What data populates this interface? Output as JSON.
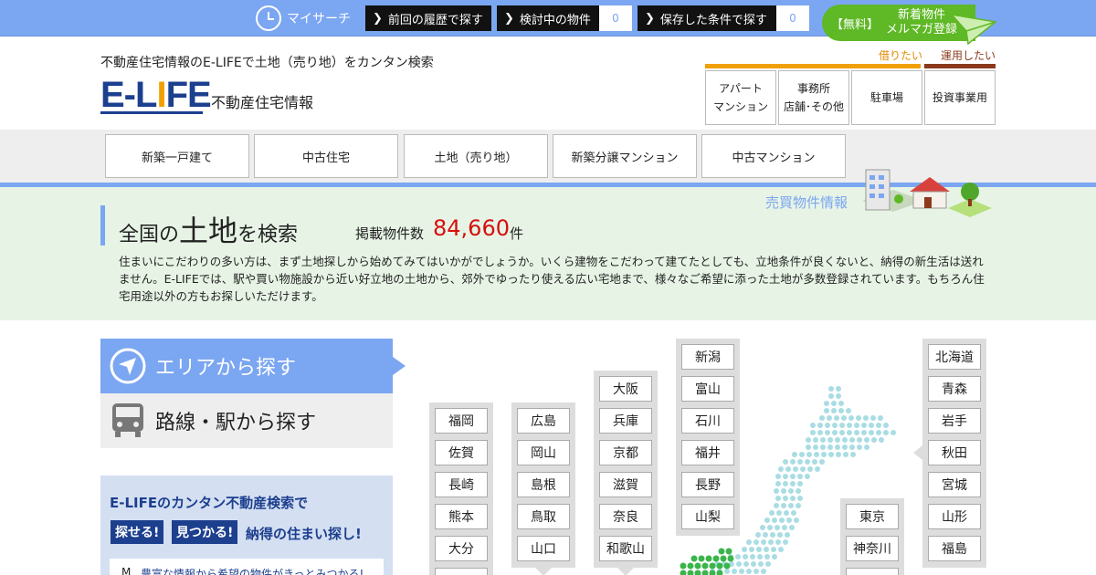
{
  "topbar": {
    "my_search": "マイサーチ",
    "history_label": "前回の履歴で探す",
    "considering_label": "検討中の物件",
    "considering_count": "0",
    "saved_label": "保存した条件で探す",
    "saved_count": "0",
    "mailmag_free": "【無料】",
    "mailmag_line1": "新着物件",
    "mailmag_line2": "メルマガ登録"
  },
  "header": {
    "tagline": "不動産住宅情報のE-LIFEで土地（売り地）をカンタン検索",
    "logo_e": "E-L",
    "logo_i": "I",
    "logo_fe": "FE",
    "logo_sub": "不動産住宅情報",
    "rent_label": "借りたい",
    "invest_label": "運用したい",
    "categories": [
      "アパート\nマンション",
      "事務所\n店舗･その他",
      "駐車場",
      "投資事業用"
    ]
  },
  "nav": {
    "tabs": [
      "新築一戸建て",
      "中古住宅",
      "土地（売り地）",
      "新築分譲マンション",
      "中古マンション"
    ]
  },
  "hero": {
    "title_pre": "全国の",
    "title_big": "土地",
    "title_post": "を検索",
    "count_label": "掲載物件数",
    "count": "84,660",
    "count_unit": "件",
    "sale_label": "売買物件情報",
    "description": "住まいにこだわりの多い方は、まず土地探しから始めてみてはいかがでしょうか。いくら建物をこだわって建てたとしても、立地条件が良くないと、納得の新生活は送れません。E-LIFEでは、駅や買い物施設から近い好立地の土地から、郊外でゆったり使える広い宅地まで、様々なご希望に添った土地が多数登録されています。もちろん住宅用途以外の方もお探しいただけます。"
  },
  "search": {
    "area_tab": "エリアから探す",
    "station_tab": "路線・駅から探す"
  },
  "promo": {
    "headline": "E-LIFEのカンタン不動産検索で",
    "badge1": "探せる!",
    "badge2": "見つかる!",
    "tail": "納得の住まい探し!",
    "item1": "豊富な情報から希望の物件がきっとみつかる!",
    "item1_marker": "M"
  },
  "regions": {
    "kyushu": [
      "福岡",
      "佐賀",
      "長崎",
      "熊本",
      "大分"
    ],
    "chugoku": [
      "広島",
      "岡山",
      "島根",
      "鳥取",
      "山口"
    ],
    "kansai": [
      "大阪",
      "兵庫",
      "京都",
      "滋賀",
      "奈良",
      "和歌山"
    ],
    "chubu": [
      "新潟",
      "富山",
      "石川",
      "福井",
      "長野",
      "山梨"
    ],
    "kanto": [
      "東京",
      "神奈川"
    ],
    "tohoku": [
      "北海道",
      "青森",
      "岩手",
      "秋田",
      "宮城",
      "山形",
      "福島"
    ]
  },
  "colors": {
    "primary_blue": "#7ba6f1",
    "logo_navy": "#1c3f8e",
    "accent_orange": "#f0a000",
    "invest_brown": "#8b3a1c",
    "hero_green": "#e7f4e5",
    "count_red": "#d6100f",
    "mailmag_green": "#5fb825"
  }
}
